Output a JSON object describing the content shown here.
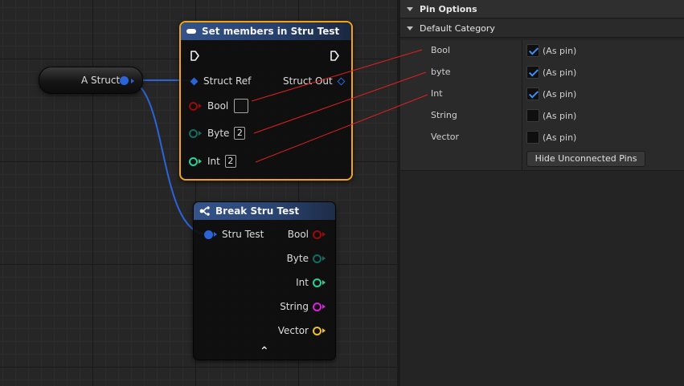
{
  "graph": {
    "var_node": {
      "label": "A Struct"
    },
    "set_node": {
      "title": "Set members in Stru Test",
      "struct_ref_label": "Struct Ref",
      "struct_out_label": "Struct Out",
      "bool_label": "Bool",
      "byte_label": "Byte",
      "byte_value": "2",
      "int_label": "Int",
      "int_value": "2"
    },
    "break_node": {
      "title": "Break Stru Test",
      "input_label": "Stru Test",
      "outputs": [
        "Bool",
        "Byte",
        "Int",
        "String",
        "Vector"
      ],
      "expand_glyph": "⌃"
    }
  },
  "colors": {
    "struct_pin": "#2a64d8",
    "bool_pin": "#9a0a0a",
    "byte_pin": "#0f6e62",
    "int_pin": "#22d49a",
    "string_pin": "#e01ee0",
    "vector_pin": "#f2c020",
    "selection": "#f2a416",
    "annotation_line": "#e02020"
  },
  "panel": {
    "section_title": "Pin Options",
    "category_title": "Default Category",
    "rows": [
      {
        "name": "Bool",
        "checked": true,
        "value": "(As pin)"
      },
      {
        "name": "byte",
        "checked": true,
        "value": "(As pin)"
      },
      {
        "name": "Int",
        "checked": true,
        "value": "(As pin)"
      },
      {
        "name": "String",
        "checked": false,
        "value": "(As pin)"
      },
      {
        "name": "Vector",
        "checked": false,
        "value": "(As pin)"
      }
    ],
    "hide_button": "Hide Unconnected Pins"
  }
}
